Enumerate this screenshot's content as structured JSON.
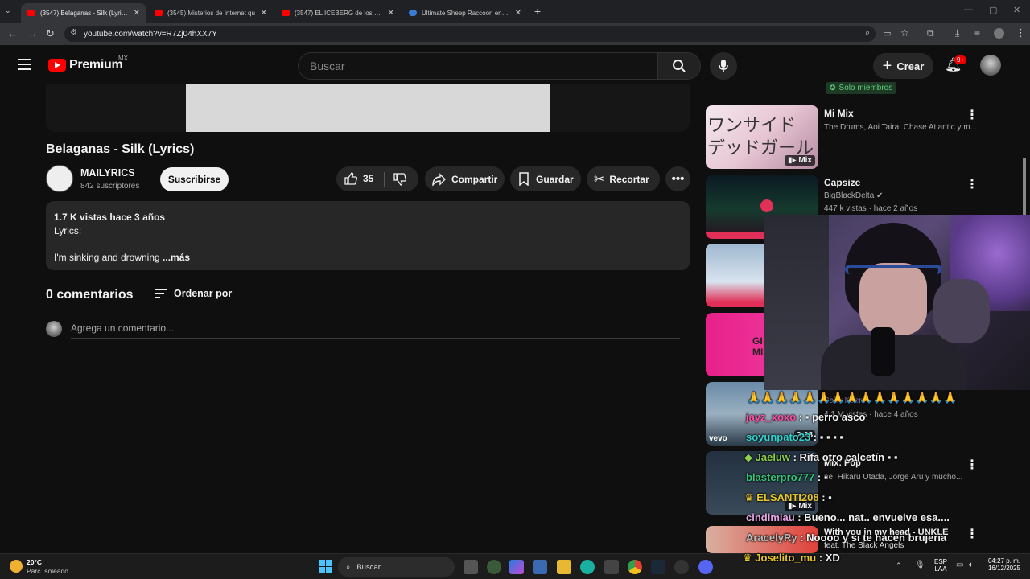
{
  "browser": {
    "tabs": [
      {
        "title": "(3547) Belaganas - Silk (Lyrics)",
        "active": true
      },
      {
        "title": "(3545) Misterios de Internet qu",
        "active": false
      },
      {
        "title": "(3547) EL ICEBERG de los MISTI",
        "active": false
      },
      {
        "title": "Ultimate Sheep Raccoon en Ste",
        "active": false
      }
    ],
    "url": "youtube.com/watch?v=R7Zj04hXX7Y"
  },
  "youtube": {
    "brand": "Premium",
    "region": "MX",
    "search_placeholder": "Buscar",
    "create_label": "Crear",
    "notif_count": "9+"
  },
  "video": {
    "title": "Belaganas - Silk (Lyrics)",
    "channel": "MAILYRICS",
    "subscribers": "842 suscriptores",
    "subscribe_label": "Suscribirse",
    "likes": "35",
    "share_label": "Compartir",
    "save_label": "Guardar",
    "clip_label": "Recortar",
    "meta": "1.7 K vistas  hace 3 años",
    "desc_line1": "Lyrics:",
    "desc_line2": "I'm sinking and drowning",
    "more_label": "...más",
    "comments_title": "0 comentarios",
    "sort_label": "Ordenar por",
    "comment_placeholder": "Agrega un comentario..."
  },
  "sidebar": {
    "members_badge": "Solo miembros",
    "items": [
      {
        "title": "Mi Mix",
        "sub1": "The Drums, Aoi Taira, Chase Atlantic y m...",
        "sub2": "",
        "badge": "Mix",
        "thumb_text": "ワンサイド\nデッドガール"
      },
      {
        "title": "Capsize",
        "sub1": "BigBlackDelta",
        "sub2": "447 k vistas · hace 2 años",
        "badge": "",
        "thumb_text": ""
      },
      {
        "title": "",
        "sub1": "",
        "sub2": "",
        "badge": "",
        "thumb_text": ""
      },
      {
        "title": "",
        "sub1": "",
        "sub2": "",
        "badge": "",
        "thumb_text": "GI\nMILO J. T"
      },
      {
        "title": "",
        "sub1": "Baby Keem",
        "sub2": "4.1 M vistas · hace 4 años",
        "badge": "2:38",
        "thumb_text": "vevo"
      },
      {
        "title": "Mix: Pop",
        "sub1": "ne, Hikaru Utada, Jorge Aru y mucho...",
        "sub2": "",
        "badge": "Mix",
        "thumb_text": ""
      },
      {
        "title": "With you in my head - UNKLE",
        "sub1": "feat. The Black Angels",
        "sub2": "",
        "badge": "",
        "thumb_text": ""
      }
    ]
  },
  "chat": [
    {
      "user": "jayz_xoxo",
      "msg": "perro asco",
      "color": "#ff4fa3"
    },
    {
      "user": "soyunpato23",
      "msg": "",
      "color": "#33d1d1"
    },
    {
      "user": "Jaeluw",
      "msg": "Rifa otro calcetín",
      "color": "#8bd14a"
    },
    {
      "user": "blasterpro777",
      "msg": "",
      "color": "#33c77a"
    },
    {
      "user": "ELSANTI208",
      "msg": "",
      "color": "#e6c62a"
    },
    {
      "user": "cindimiau",
      "msg": "Bueno... nat.. envuelve esa....",
      "color": "#e8a8e8"
    },
    {
      "user": "AracelyRy",
      "msg": "Noooo y si te hacen brujeria",
      "color": "#bbbbbb"
    },
    {
      "user": "Joselito_mu",
      "msg": "XD",
      "color": "#e6c62a"
    }
  ],
  "taskbar": {
    "weather_temp": "20°C",
    "weather_desc": "Parc. soleado",
    "search_label": "Buscar",
    "lang": "ESP",
    "layout": "LAA",
    "time": "04:27 p. m.",
    "date": "16/12/2025"
  }
}
